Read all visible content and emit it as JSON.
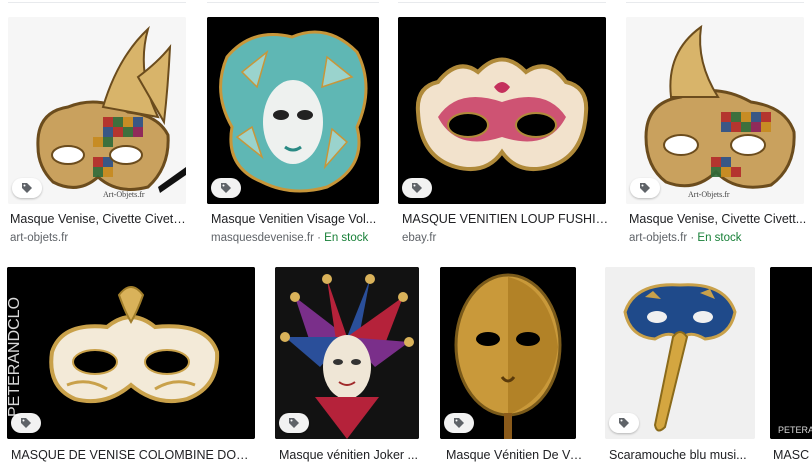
{
  "results_row1": [
    {
      "title": "Masque Venise, Civette Civett...",
      "source": "art-objets.fr",
      "stock": "",
      "watermark": "Art-Objets.fr"
    },
    {
      "title": "Masque Venitien Visage Vol...",
      "source": "masquesdevenise.fr",
      "stock": "En stock",
      "watermark": ""
    },
    {
      "title": "MASQUE VENITIEN LOUP FUSHIA ...",
      "source": "ebay.fr",
      "stock": "",
      "watermark": ""
    },
    {
      "title": "Masque Venise, Civette Civett...",
      "source": "art-objets.fr",
      "stock": "En stock",
      "watermark": "Art-Objets.fr"
    }
  ],
  "results_row2": [
    {
      "title": "MASQUE DE VENISE COLOMBINE DORE E...",
      "source": "",
      "watermark": "PETERANDCLO"
    },
    {
      "title": "Masque vénitien Joker ...",
      "source": ""
    },
    {
      "title": "Masque Vénitien De Ve...",
      "source": ""
    },
    {
      "title": "Scaramouche blu musi...",
      "source": ""
    },
    {
      "title": "MASC",
      "source": "",
      "watermark": "PETERAND"
    }
  ],
  "stock_separator": "·",
  "colors": {
    "stock_green": "#188038",
    "meta_gray": "#5f6368",
    "title": "#202124"
  },
  "icons": {
    "tag": "tag-icon"
  }
}
